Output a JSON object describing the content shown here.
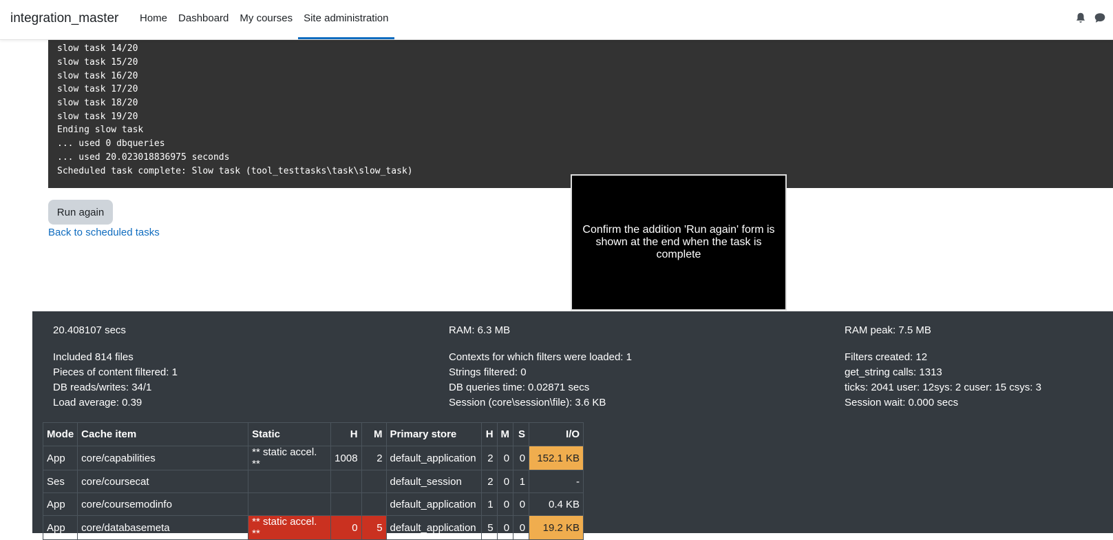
{
  "navbar": {
    "brand": "integration_master",
    "items": [
      "Home",
      "Dashboard",
      "My courses",
      "Site administration"
    ],
    "active": "Site administration",
    "icons": [
      "bell-icon",
      "chat-icon"
    ]
  },
  "console": {
    "lines": [
      "slow task 14/20",
      "slow task 15/20",
      "slow task 16/20",
      "slow task 17/20",
      "slow task 18/20",
      "slow task 19/20",
      "Ending slow task",
      "... used 0 dbqueries",
      "... used 20.023018836975 seconds",
      "Scheduled task complete: Slow task (tool_testtasks\\task\\slow_task)"
    ]
  },
  "actions": {
    "run_again": "Run again",
    "back": "Back to scheduled tasks"
  },
  "overlay": {
    "text": "Confirm the addition 'Run again' form is shown at the end when the task is complete"
  },
  "perf": {
    "col1": [
      "20.408107 secs",
      "Included 814 files",
      "Pieces of content filtered: 1",
      "DB reads/writes: 34/1",
      "Load average: 0.39"
    ],
    "col2": [
      "RAM: 6.3 MB",
      "Contexts for which filters were loaded: 1",
      "Strings filtered: 0",
      "DB queries time: 0.02871 secs",
      "Session (core\\session\\file): 3.6 KB"
    ],
    "col3": [
      "RAM peak: 7.5 MB",
      "Filters created: 12",
      "get_string calls: 1313",
      "ticks: 2041 user: 12sys: 2 cuser: 15 csys: 3",
      "Session wait: 0.000 secs"
    ]
  },
  "cache_table": {
    "headers": [
      "Mode",
      "Cache item",
      "Static",
      "H",
      "M",
      "Primary store",
      "H",
      "M",
      "S",
      "I/O"
    ],
    "rows": [
      {
        "mode": "App",
        "item": "core/capabilities",
        "static": "** static accel. **",
        "sh": "1008",
        "sm": "2",
        "store": "default_application",
        "h": "2",
        "m": "0",
        "s": "0",
        "io": "152.1 KB"
      },
      {
        "mode": "Ses",
        "item": "core/coursecat",
        "static": "",
        "sh": "",
        "sm": "",
        "store": "default_session",
        "h": "2",
        "m": "0",
        "s": "1",
        "io": "-"
      },
      {
        "mode": "App",
        "item": "core/coursemodinfo",
        "static": "",
        "sh": "",
        "sm": "",
        "store": "default_application",
        "h": "1",
        "m": "0",
        "s": "0",
        "io": "0.4 KB"
      },
      {
        "mode": "App",
        "item": "core/databasemeta",
        "static": "** static accel. **",
        "sh": "0",
        "sm": "5",
        "store": "default_application",
        "h": "5",
        "m": "0",
        "s": "0",
        "io": "19.2 KB"
      }
    ]
  },
  "colors": {
    "accent": "#0f6cbf",
    "console_bg": "#333333",
    "footer_bg": "#343a40",
    "warning": "#f0ad4e",
    "danger": "#ca3120"
  }
}
